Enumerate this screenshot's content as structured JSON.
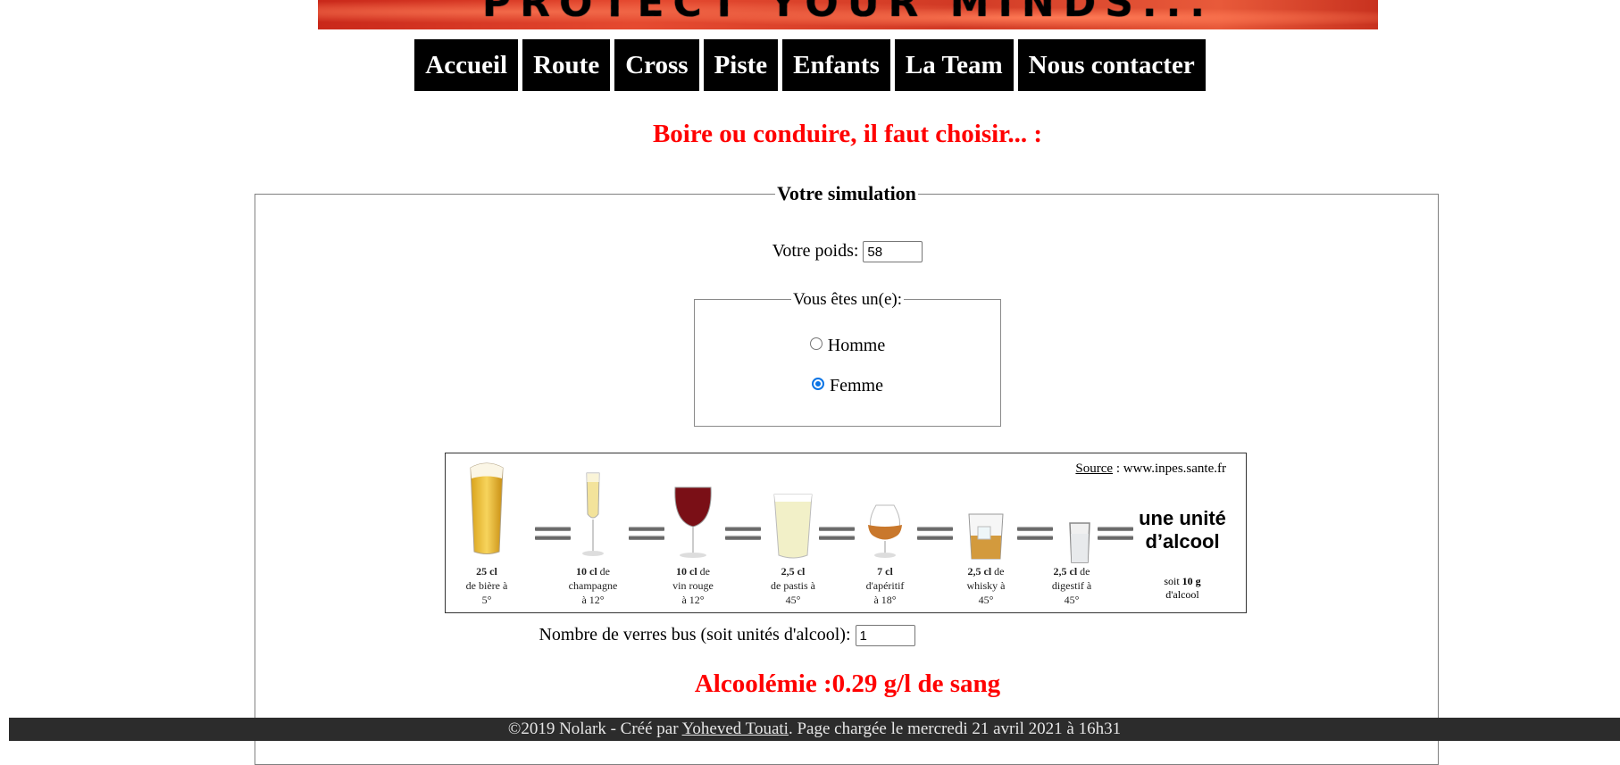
{
  "banner": {
    "text": "PROTECT YOUR MINDS..."
  },
  "nav": {
    "items": [
      "Accueil",
      "Route",
      "Cross",
      "Piste",
      "Enfants",
      "La Team",
      "Nous contacter"
    ]
  },
  "heading": "Boire ou conduire, il faut choisir... :",
  "simulation": {
    "legend": "Votre simulation",
    "weight_label": "Votre poids:",
    "weight_value": "58",
    "sex_legend": "Vous êtes un(e):",
    "sex_options": [
      {
        "label": "Homme",
        "checked": false
      },
      {
        "label": "Femme",
        "checked": true
      }
    ],
    "drinks_image": {
      "source_label": "Source",
      "source_value": " : www.inpes.sante.fr",
      "drinks": [
        {
          "amount": "25 cl",
          "l1": "de bière à",
          "l2": "5°"
        },
        {
          "amount": "10 cl",
          "l1": "champagne",
          "l2": "à 12°",
          "suffix": " de"
        },
        {
          "amount": "10 cl",
          "l1": "vin rouge",
          "l2": "à 12°",
          "suffix": " de"
        },
        {
          "amount": "2,5 cl",
          "l1": "de pastis à",
          "l2": "45°"
        },
        {
          "amount": "7 cl",
          "l1": "d'apéritif",
          "l2": "à 18°"
        },
        {
          "amount": "2,5 cl",
          "l1": "whisky à",
          "l2": "45°",
          "suffix": " de"
        },
        {
          "amount": "2,5 cl",
          "l1": "digestif à",
          "l2": "45°",
          "suffix": " de"
        }
      ],
      "unit_line1": "une unité",
      "unit_line2": "d’alcool",
      "unit_small_prefix": "soit ",
      "unit_small_amount": "10 g",
      "unit_small_suffix": "d'alcool"
    },
    "glasses_label": "Nombre de verres bus (soit unités d'alcool):",
    "glasses_value": "1",
    "result": "Alcoolémie :0.29 g/l de sang"
  },
  "footer": {
    "prefix": "©2019 Nolark - Créé par ",
    "author": "Yoheved Touati",
    "suffix": ". Page chargée le mercredi 21 avril 2021 à 16h31"
  },
  "colors": {
    "nav_bg": "#000000",
    "heading": "#ff0000",
    "footer_bg": "#2c2c2c",
    "radio_accent": "#0b74e5"
  }
}
